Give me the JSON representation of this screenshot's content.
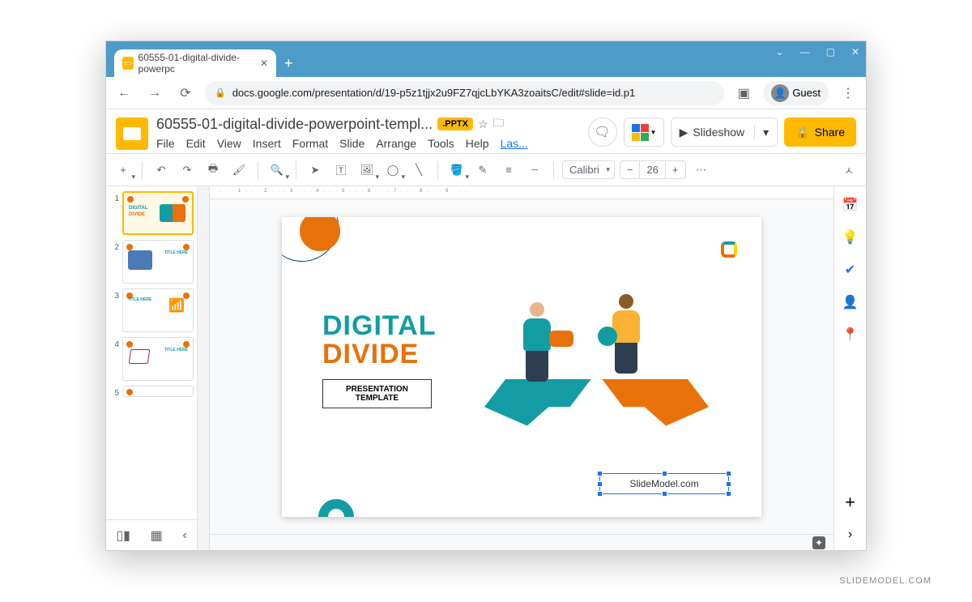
{
  "browser": {
    "tab_title": "60555-01-digital-divide-powerpc",
    "url": "docs.google.com/presentation/d/19-p5z1tjjx2u9FZ7qjcLbYKA3zoaitsC/edit#slide=id.p1",
    "guest_label": "Guest"
  },
  "app": {
    "doc_title": "60555-01-digital-divide-powerpoint-templ...",
    "badge": ".PPTX",
    "menus": [
      "File",
      "Edit",
      "View",
      "Insert",
      "Format",
      "Slide",
      "Arrange",
      "Tools",
      "Help"
    ],
    "last_edit": "Las...",
    "slideshow_label": "Slideshow",
    "share_label": "Share"
  },
  "toolbar": {
    "font": "Calibri",
    "size": "26"
  },
  "thumbs": [
    "1",
    "2",
    "3",
    "4",
    "5"
  ],
  "thumb_labels": {
    "t1_a": "DIGITAL",
    "t1_b": "DIVIDE",
    "t2": "TITLE HERE",
    "t3": "TITLE HERE",
    "t4": "TITLE HERE"
  },
  "slide": {
    "title1": "DIGITAL",
    "title2": "DIVIDE",
    "sub1": "PRESENTATION",
    "sub2": "TEMPLATE",
    "selected_text": "SlideModel.com"
  },
  "watermark": "SLIDEMODEL.COM"
}
